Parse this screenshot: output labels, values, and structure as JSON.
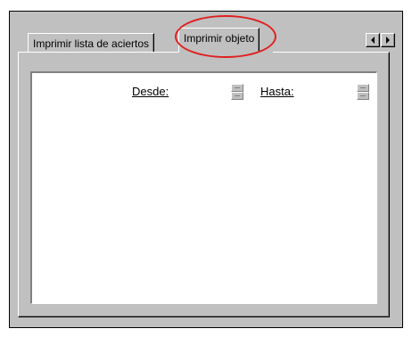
{
  "tabs": [
    {
      "label": "Imprimir lista de aciertos"
    },
    {
      "label": "Imprimir objeto",
      "selected": true
    }
  ],
  "tab_scroll": {
    "left_icon": "arrow-left-icon",
    "right_icon": "arrow-right-icon"
  },
  "form": {
    "from_label": "Desde:",
    "to_label": "Hasta:"
  },
  "annotation": {
    "color": "#e02020"
  }
}
